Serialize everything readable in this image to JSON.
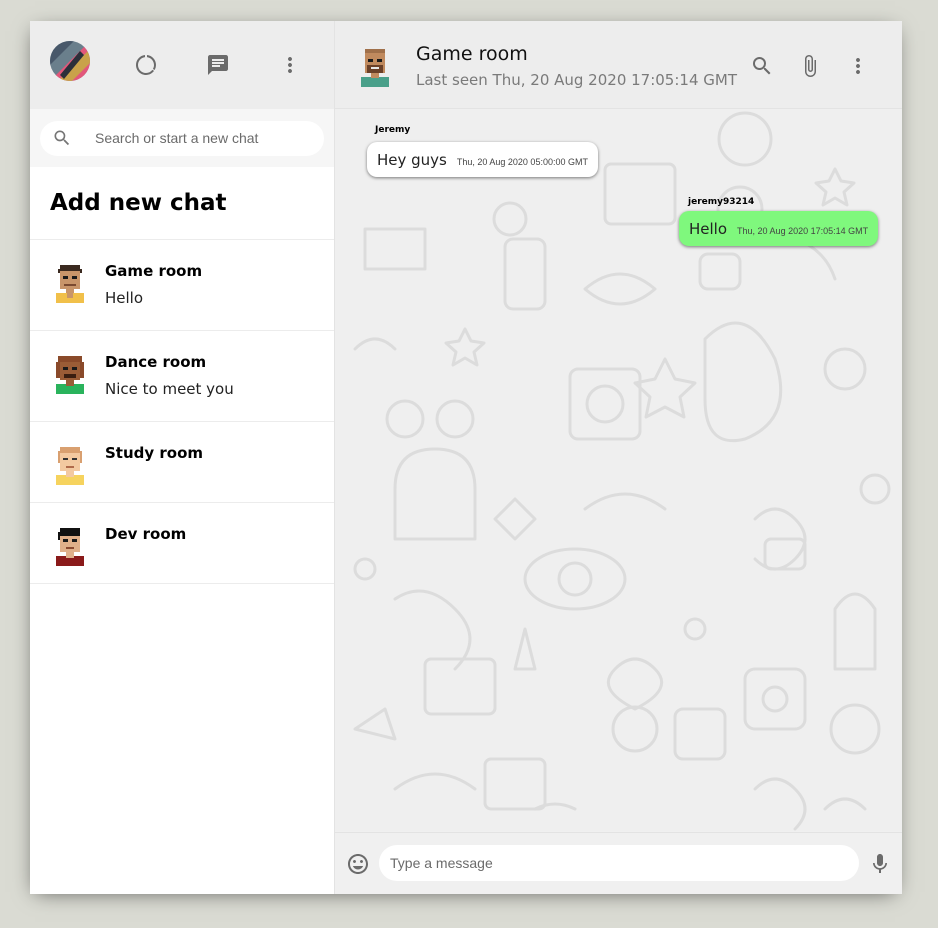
{
  "sidebar": {
    "search_placeholder": "Search or start a new chat",
    "add_new_chat": "Add new chat",
    "rooms": [
      {
        "name": "Game room",
        "last_message": "Hello"
      },
      {
        "name": "Dance room",
        "last_message": "Nice to meet you"
      },
      {
        "name": "Study room",
        "last_message": ""
      },
      {
        "name": "Dev room",
        "last_message": ""
      }
    ],
    "header_icons": [
      "avatar",
      "status-icon",
      "chat-icon",
      "more-vert-icon"
    ]
  },
  "chat": {
    "room_name": "Game room",
    "last_seen": "Last seen Thu, 20 Aug 2020 17:05:14 GMT",
    "header_icons": [
      "search-icon",
      "attach-icon",
      "more-vert-icon"
    ],
    "messages": [
      {
        "sender": "Jeremy",
        "text": "Hey guys",
        "timestamp": "Thu, 20 Aug 2020 05:00:00 GMT",
        "mine": false
      },
      {
        "sender": "jeremy93214",
        "text": "Hello",
        "timestamp": "Thu, 20 Aug 2020 17:05:14 GMT",
        "mine": true
      }
    ],
    "input_placeholder": "Type a message"
  },
  "colors": {
    "background": "#dadbd3",
    "header": "#ededed",
    "own_bubble": "#7ff87d",
    "other_bubble": "#ffffff",
    "icon": "#6b6b6b"
  }
}
